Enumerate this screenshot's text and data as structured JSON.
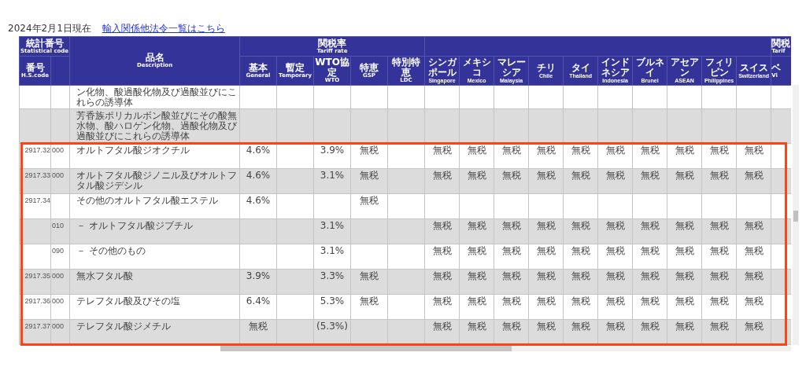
{
  "as_of": "2024年2月1日現在",
  "link": "輸入関係他法令一覧はこちら",
  "header": {
    "statistical_code": {
      "ja": "統計番号",
      "en": "Statistical code"
    },
    "hs_code": {
      "ja": "番号",
      "en": "H.S.code"
    },
    "description": {
      "ja": "品名",
      "en": "Description"
    },
    "tariff_rate": {
      "ja": "関税率",
      "en": "Tariff rate"
    },
    "tariff_rate_cut": {
      "ja": "関税",
      "en": "Tarif"
    },
    "rate_columns": [
      {
        "ja": "基本",
        "en": "General"
      },
      {
        "ja": "暫定",
        "en": "Temporary"
      },
      {
        "ja": "WTO協定",
        "en": "WTO"
      },
      {
        "ja": "特恵",
        "en": "GSP"
      },
      {
        "ja": "特別特恵",
        "en": "LDC"
      }
    ],
    "country_columns": [
      {
        "ja": "シンガポール",
        "en": "Singapore"
      },
      {
        "ja": "メキシコ",
        "en": "Mexico"
      },
      {
        "ja": "マレーシア",
        "en": "Malaysia"
      },
      {
        "ja": "チリ",
        "en": "Chile"
      },
      {
        "ja": "タイ",
        "en": "Thailand"
      },
      {
        "ja": "インドネシア",
        "en": "Indonesia"
      },
      {
        "ja": "ブルネイ",
        "en": "Brunei"
      },
      {
        "ja": "アセアン",
        "en": "ASEAN"
      },
      {
        "ja": "フィリピン",
        "en": "Philippines"
      },
      {
        "ja": "スイス",
        "en": "Switzerland"
      }
    ],
    "cut_column": {
      "ja": "ベ",
      "en": "Vi"
    }
  },
  "rows": [
    {
      "description": "ン化物、酸過酸化物及び過酸並びにこれらの誘導体",
      "rates": {}
    },
    {
      "description": "芳香族ポリカルボン酸並びにその酸無水物、酸ハロゲン化物、過酸化物及び過酸並びにこれらの誘導体",
      "rates": {}
    },
    {
      "code": "2917.32",
      "sub": "000",
      "description": "オルトフタル酸ジオクチル",
      "rates": {
        "general": "4.6%",
        "wto": "3.9%",
        "gsp": "無税"
      },
      "countries": [
        "無税",
        "無税",
        "無税",
        "無税",
        "無税",
        "無税",
        "無税",
        "無税",
        "無税",
        "無税"
      ]
    },
    {
      "code": "2917.33",
      "sub": "000",
      "description": "オルトフタル酸ジノニル及びオルトフタル酸ジデシル",
      "rates": {
        "general": "4.6%",
        "wto": "3.1%",
        "gsp": "無税"
      },
      "countries": [
        "無税",
        "無税",
        "無税",
        "無税",
        "無税",
        "無税",
        "無税",
        "無税",
        "無税",
        "無税"
      ]
    },
    {
      "code": "2917.34",
      "description": "その他のオルトフタル酸エステル",
      "rates": {
        "general": "4.6%",
        "gsp": "無税"
      }
    },
    {
      "sub": "010",
      "description": "－ オルトフタル酸ジブチル",
      "rates": {
        "wto": "3.1%"
      },
      "countries": [
        "無税",
        "無税",
        "無税",
        "無税",
        "無税",
        "無税",
        "無税",
        "無税",
        "無税",
        "無税"
      ]
    },
    {
      "sub": "090",
      "description": "－ その他のもの",
      "rates": {
        "wto": "3.1%"
      },
      "countries": [
        "無税",
        "無税",
        "無税",
        "無税",
        "無税",
        "無税",
        "無税",
        "無税",
        "無税",
        "無税"
      ]
    },
    {
      "code": "2917.35",
      "sub": "000",
      "description": "無水フタル酸",
      "rates": {
        "general": "3.9%",
        "wto": "3.3%",
        "gsp": "無税"
      },
      "countries": [
        "無税",
        "無税",
        "無税",
        "無税",
        "無税",
        "無税",
        "無税",
        "無税",
        "無税",
        "無税"
      ]
    },
    {
      "code": "2917.36",
      "sub": "000",
      "description": "テレフタル酸及びその塩",
      "rates": {
        "general": "6.4%",
        "wto": "5.3%",
        "gsp": "無税"
      },
      "countries": [
        "無税",
        "無税",
        "無税",
        "無税",
        "無税",
        "無税",
        "無税",
        "無税",
        "無税",
        "無税"
      ]
    },
    {
      "code": "2917.37",
      "sub": "000",
      "description": "テレフタル酸ジメチル",
      "rates": {
        "general": "無税",
        "wto": "(5.3%)"
      },
      "countries": [
        "無税",
        "無税",
        "無税",
        "無税",
        "無税",
        "無税",
        "無税",
        "無税",
        "無税",
        "無税"
      ]
    }
  ]
}
